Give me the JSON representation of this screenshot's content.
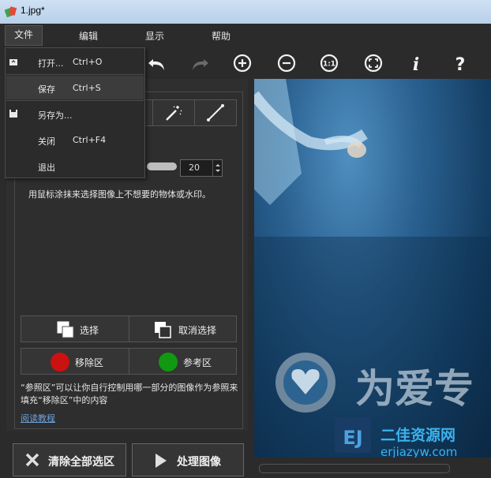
{
  "window": {
    "title": "1.jpg*"
  },
  "menu": {
    "file": "文件",
    "edit": "编辑",
    "view": "显示",
    "help": "帮助"
  },
  "file_menu": {
    "items": [
      {
        "label": "打开...",
        "shortcut": "Ctrl+O"
      },
      {
        "label": "保存",
        "shortcut": "Ctrl+S"
      },
      {
        "label": "另存为...",
        "shortcut": ""
      },
      {
        "label": "关闭",
        "shortcut": "Ctrl+F4"
      },
      {
        "label": "退出",
        "shortcut": ""
      }
    ]
  },
  "toolbar": {
    "icons": [
      "undo-icon",
      "redo-icon",
      "zoom-in-icon",
      "zoom-out-icon",
      "actual-size-icon",
      "fit-window-icon",
      "info-icon",
      "help-icon"
    ],
    "actual_size_label": "1:1",
    "info_label": "i",
    "help_label": "?"
  },
  "panel": {
    "brush_size": "20",
    "hint": "用鼠标涂抹来选择图像上不想要的物体或水印。",
    "select_label": "选择",
    "deselect_label": "取消选择",
    "remove_label": "移除区",
    "reference_label": "参考区",
    "description": "“参照区”可以让你自行控制用哪一部分的图像作为参照来填充“移除区”中的内容",
    "tutorial_link": "阅读教程",
    "clear_label": "清除全部选区",
    "process_label": "处理图像"
  },
  "colors": {
    "remove": "#cc1111",
    "reference": "#119911",
    "link": "#6ea2d8"
  },
  "watermark": {
    "site_cn": "二佳资源网",
    "site_url": "erjiazyw.com",
    "brand_text": "为爱专"
  }
}
